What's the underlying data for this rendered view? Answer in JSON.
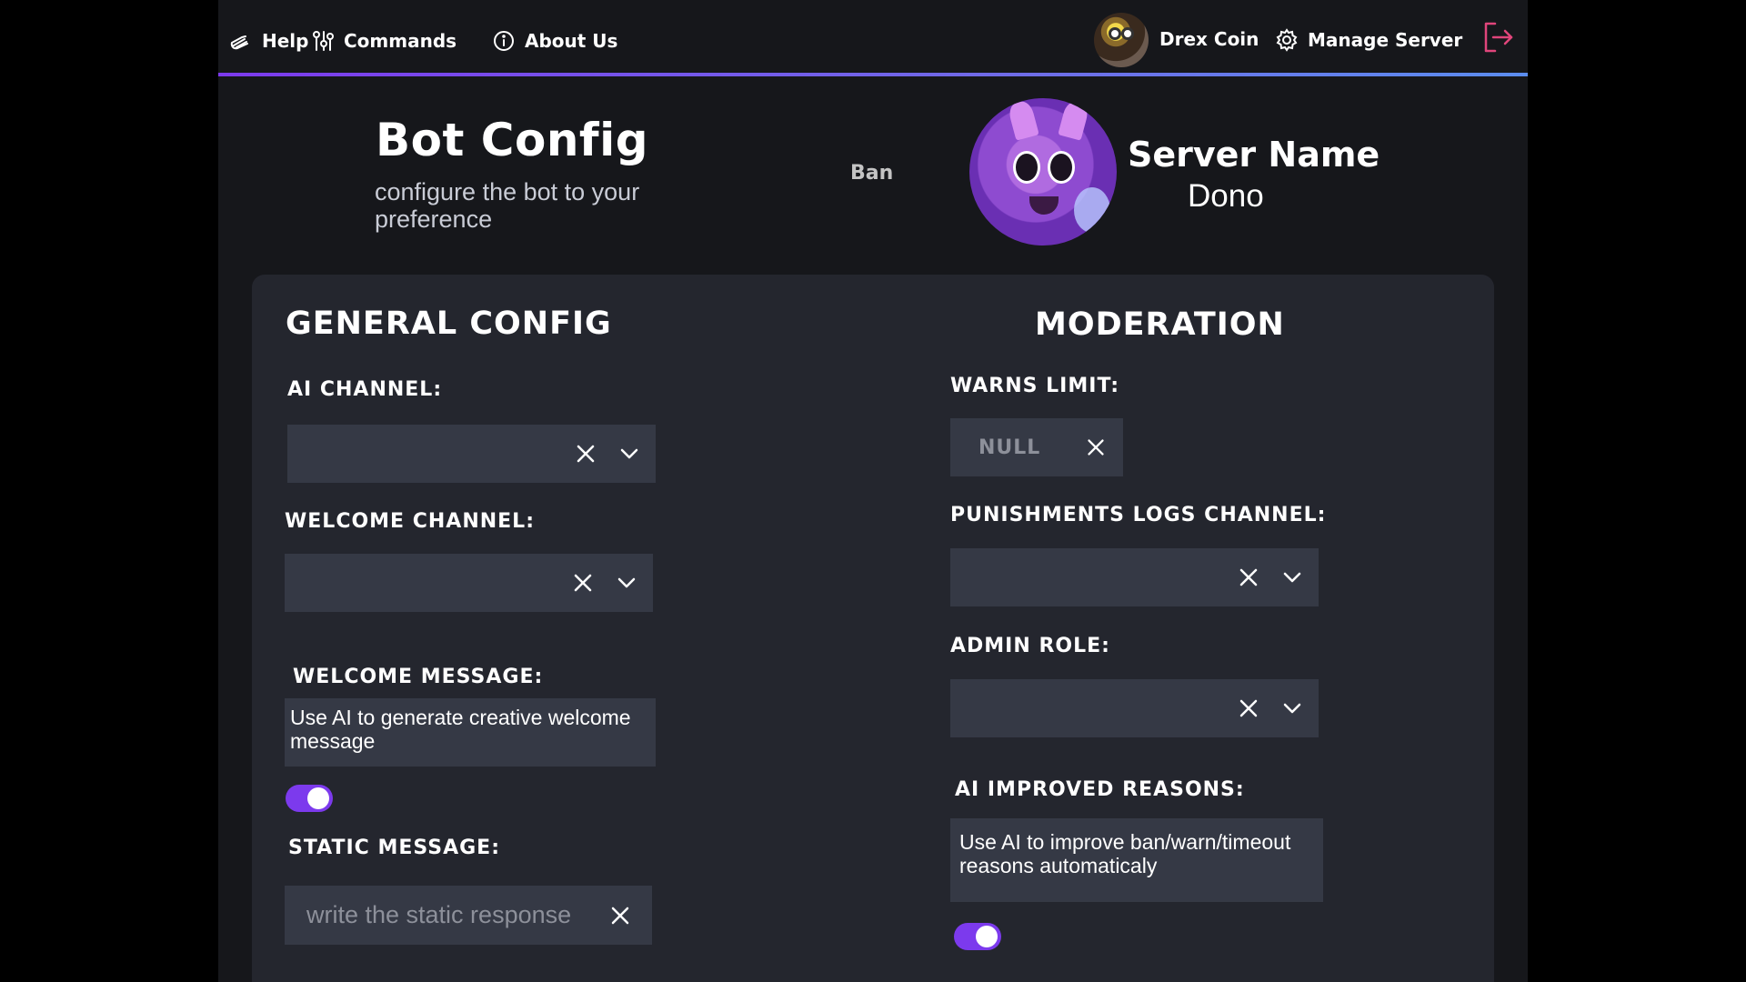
{
  "nav": {
    "help_label": "Help",
    "commands_label": "Commands",
    "about_label": "About Us",
    "user_label": "Drex Coin",
    "manage_label": "Manage Server"
  },
  "header": {
    "title": "Bot Config",
    "subtitle": "configure the bot to your preference",
    "ban_label": "Ban",
    "server_label": "Server Name",
    "server_value": "Dono"
  },
  "general": {
    "title": "GENERAL CONFIG",
    "ai_channel_label": "AI CHANNEL:",
    "welcome_channel_label": "WELCOME CHANNEL:",
    "welcome_message_label": "WELCOME MESSAGE:",
    "welcome_message_text": "Use AI to generate creative welcome message",
    "welcome_ai_toggle": true,
    "static_message_label": "STATIC MESSAGE:",
    "static_message_placeholder": "write the static response"
  },
  "moderation": {
    "title": "MODERATION",
    "warns_limit_label": "WARNS LIMIT:",
    "warns_limit_value": "NULL",
    "punishments_logs_label": "PUNISHMENTS LOGS CHANNEL:",
    "admin_role_label": "ADMIN ROLE:",
    "ai_reasons_label": "AI IMPROVED REASONS:",
    "ai_reasons_text": "Use AI to improve ban/warn/timeout reasons automaticaly",
    "ai_reasons_toggle": true
  },
  "colors": {
    "accent": "#7c3aed",
    "logout": "#e0457b",
    "field_bg": "#353945",
    "panel_bg": "#24262e"
  }
}
